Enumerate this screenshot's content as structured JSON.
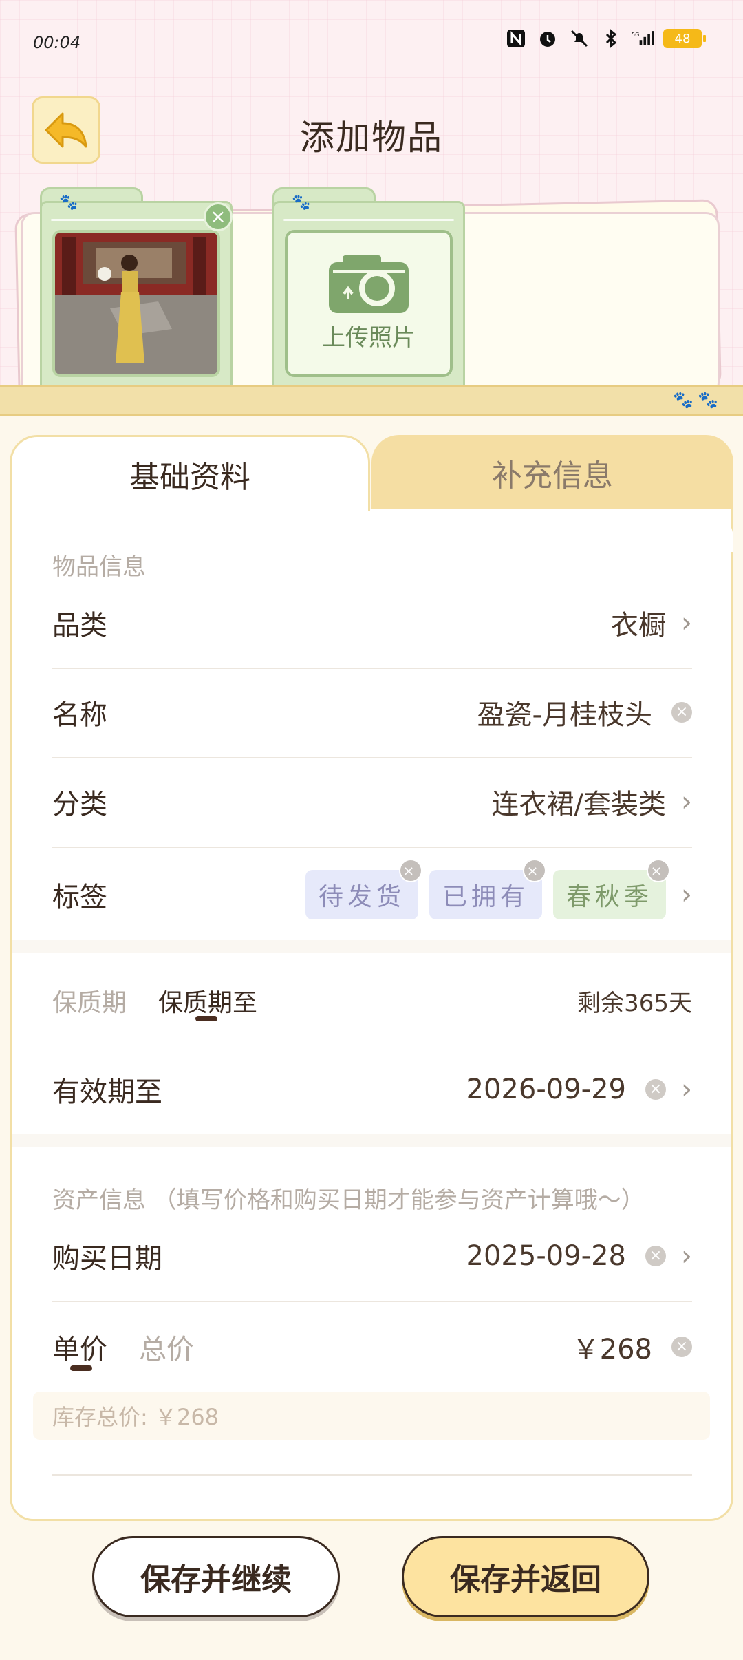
{
  "status_bar": {
    "time": "00:04",
    "battery": "48",
    "network": "5G"
  },
  "header": {
    "title": "添加物品"
  },
  "photos": {
    "upload_label": "上传照片"
  },
  "tabs": [
    {
      "label": "基础资料",
      "active": true
    },
    {
      "label": "补充信息",
      "active": false
    }
  ],
  "item_info": {
    "section_label": "物品信息",
    "category_label": "品类",
    "category_value": "衣橱",
    "name_label": "名称",
    "name_value": "盈瓷-月桂枝头",
    "type_label": "分类",
    "type_value": "连衣裙/套装类",
    "tags_label": "标签",
    "tags": [
      "待发货",
      "已拥有",
      "春秋季"
    ]
  },
  "shelf_life": {
    "tab_period": "保质期",
    "tab_until": "保质期至",
    "remaining": "剩余365天",
    "expiry_label": "有效期至",
    "expiry_value": "2026-09-29"
  },
  "asset_info": {
    "section_label": "资产信息 （填写价格和购买日期才能参与资产计算哦～）",
    "purchase_date_label": "购买日期",
    "purchase_date_value": "2025-09-28",
    "unit_price_tab": "单价",
    "total_price_tab": "总价",
    "price_value": "￥268",
    "stock_total": "库存总价: ￥268"
  },
  "actions": {
    "save_continue": "保存并继续",
    "save_return": "保存并返回"
  },
  "colors": {
    "accent_yellow": "#fde3a0",
    "tab_inactive": "#f5dea3",
    "folder_green": "#d7e9c6",
    "text_dark": "#3a2a20"
  }
}
